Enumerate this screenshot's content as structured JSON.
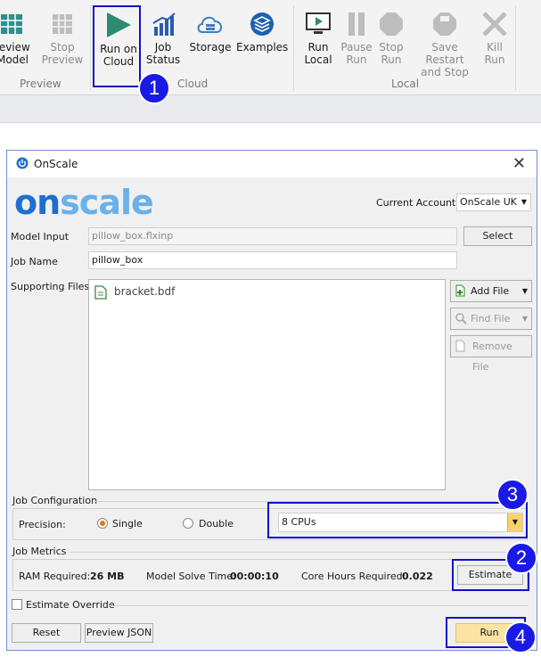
{
  "ribbon": {
    "buttons": [
      {
        "id": "preview-model",
        "label_1": "review",
        "label_2": "Model"
      },
      {
        "id": "stop-preview",
        "label_1": "Stop",
        "label_2": "Preview"
      },
      {
        "id": "run-on-cloud",
        "label_1": "Run on",
        "label_2": "Cloud"
      },
      {
        "id": "job-status",
        "label_1": "Job",
        "label_2": "Status"
      },
      {
        "id": "storage",
        "label_1": "Storage",
        "label_2": ""
      },
      {
        "id": "examples",
        "label_1": "Examples",
        "label_2": ""
      },
      {
        "id": "run-local",
        "label_1": "Run",
        "label_2": "Local"
      },
      {
        "id": "pause-run",
        "label_1": "Pause",
        "label_2": "Run"
      },
      {
        "id": "stop-run",
        "label_1": "Stop",
        "label_2": "Run"
      },
      {
        "id": "save-restart",
        "label_1": "Save Restart",
        "label_2": "and Stop"
      },
      {
        "id": "kill-run",
        "label_1": "Kill",
        "label_2": "Run"
      }
    ],
    "groups": {
      "preview": "Preview",
      "cloud": "Cloud",
      "local": "Local"
    }
  },
  "badges": {
    "b1": "1",
    "b2": "2",
    "b3": "3",
    "b4": "4"
  },
  "dialog": {
    "title": "OnScale",
    "close": "✕",
    "logo": "onscale",
    "account_label": "Current Account:",
    "account_value": "OnScale UK",
    "model_input_label": "Model Input",
    "model_input_value": "pillow_box.flxinp",
    "select_button": "Select",
    "job_name_label": "Job Name",
    "job_name_value": "pillow_box",
    "supporting_files_label": "Supporting Files",
    "files": [
      "bracket.bdf"
    ],
    "add_file": "Add File",
    "find_file": "Find File",
    "remove_file": "Remove File",
    "job_config_label": "Job Configuration",
    "precision_label": "Precision:",
    "precision_single": "Single",
    "precision_double": "Double",
    "cpus_value": "8 CPUs",
    "job_metrics_label": "Job Metrics",
    "ram_label": "RAM Required:",
    "ram_value": "26 MB",
    "solve_label": "Model Solve Time:",
    "solve_value": "00:00:10",
    "core_label": "Core Hours Required:",
    "core_value": "0.022",
    "estimate_button": "Estimate",
    "estimate_override": "Estimate Override",
    "reset_button": "Reset",
    "preview_json_button": "Preview JSON",
    "run_button": "Run"
  },
  "colors": {
    "highlight": "#1111cc",
    "badge": "#1a1ae6",
    "onscale_blue": "#1e6fd0",
    "onscale_light": "#6ab0ea",
    "accent_orange": "#e07b00",
    "run_yellow": "#fbe3a3"
  }
}
